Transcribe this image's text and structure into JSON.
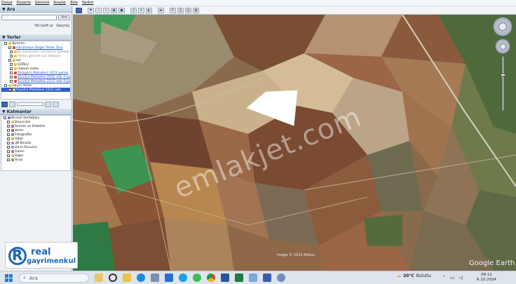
{
  "menu": [
    "Dosya",
    "Düzenle",
    "Görüntü",
    "Araçlar",
    "Ekle",
    "Yardım"
  ],
  "search": {
    "panel_title": "Ara",
    "placeholder": "",
    "button": "Ara",
    "route_label": "Yol tarifi al",
    "history_label": "Geçmiş"
  },
  "places": {
    "panel_title": "Yerler",
    "items": [
      {
        "label": "Yerlerim",
        "style": "normal"
      },
      {
        "label": "Görülmeye Değer Yerler Turu",
        "style": "link"
      },
      {
        "label": "Bu klasördeki resimlerin içerdiği",
        "style": "grey"
      },
      {
        "label": "Yerleri görmek için tıklayın",
        "style": "grey"
      },
      {
        "label": "sur",
        "style": "normal"
      },
      {
        "label": "ÇORLU",
        "style": "normal"
      },
      {
        "label": "realum video",
        "style": "normal"
      },
      {
        "label": "Türkgücü Mahallesi 1674 parsel",
        "style": "link"
      },
      {
        "label": "Yusufça Mahallesi 2032 ada 4 parsel",
        "style": "link"
      },
      {
        "label": "Yusufça Mahallesi 2222 ada 4 parsel",
        "style": "link"
      },
      {
        "label": "Geçici Yerler",
        "style": "normal"
      },
      {
        "label": "Yusufça Mahallesi 2222 ada",
        "style": "selected"
      }
    ]
  },
  "layers": {
    "panel_title": "Katmanlar",
    "items": [
      "Birincil Veritabanı",
      "Duyurular",
      "Sınırlar ve Etiketler",
      "Yerler",
      "Fotoğraflar",
      "Yollar",
      "3B Binalar",
      "Hava Durumu",
      "Galeri",
      "Diğer",
      "Arazi"
    ]
  },
  "map": {
    "watermark": "emlakjet.com",
    "credit": "Image © 2024 Airbus",
    "logo": "Google Earth"
  },
  "brand": {
    "letter": "R",
    "line1": "real",
    "line2": "gayrimenkul"
  },
  "taskbar": {
    "search_placeholder": "Ara",
    "weather": "20°C",
    "weather_desc": "Bulutlu",
    "time": "09:11",
    "date": "6.10.2024"
  },
  "colors": {
    "sidebar_bg": "#eef2f6",
    "link": "#1a4fbf",
    "selected": "#2f62c4",
    "brand_blue": "#1e66b5"
  }
}
